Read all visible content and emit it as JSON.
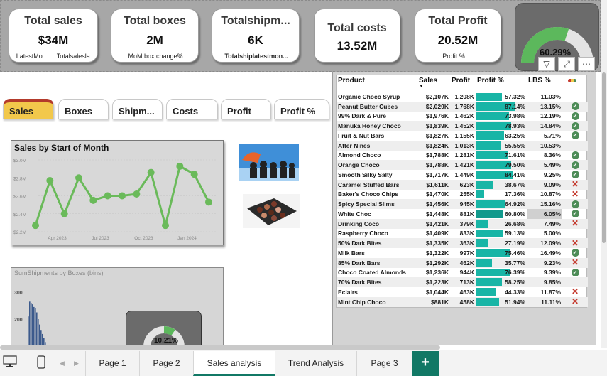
{
  "kpis": [
    {
      "title": "Total sales",
      "value": "$34M",
      "sub1": "LatestMo...",
      "sub2": "Totalsalesla..."
    },
    {
      "title": "Total boxes",
      "value": "2M",
      "sub1": "MoM box change%"
    },
    {
      "title": "Totalshipm...",
      "value": "6K",
      "sub1": "Totalshiplatestmon..."
    },
    {
      "title": "Total costs",
      "value": "13.52M"
    },
    {
      "title": "Total Profit",
      "value": "20.52M",
      "sub1": "Profit %"
    }
  ],
  "gauge": {
    "value": "60.29%",
    "fraction": 0.6029,
    "fill_color": "#5cb85c",
    "track_color": "#e4e4e4"
  },
  "visual_icons": [
    "filter-icon",
    "focus-mode-icon",
    "more-options-icon"
  ],
  "tabs": [
    "Sales",
    "Boxes",
    "Shipm...",
    "Costs",
    "Profit",
    "Profit %"
  ],
  "line_chart": {
    "chart_data": {
      "type": "line",
      "title": "Sales by Start of Month",
      "y_tick_labels": [
        "$3.0M",
        "$2.8M",
        "$2.6M",
        "$2.4M",
        "$2.2M"
      ],
      "y_ticks": [
        3.0,
        2.8,
        2.6,
        2.4,
        2.2
      ],
      "x_tick_labels": [
        "Apr 2023",
        "Jul 2023",
        "Oct 2023",
        "Jan 2024"
      ],
      "ylim": [
        2.2,
        3.0
      ],
      "values": [
        2.27,
        2.77,
        2.4,
        2.8,
        2.55,
        2.6,
        2.6,
        2.62,
        2.86,
        2.27,
        2.93,
        2.84,
        2.53
      ],
      "line_color": "#6aba5a"
    }
  },
  "bar_chart": {
    "chart_data": {
      "type": "bar",
      "title": "SumShipments by Boxes (bins)",
      "y_tick_labels": [
        "300",
        "200"
      ],
      "values": [
        210,
        265,
        260,
        255,
        245,
        240,
        225,
        200,
        180,
        160,
        145,
        130,
        115,
        100,
        90,
        80,
        70,
        60,
        52,
        45,
        40,
        35,
        30,
        26,
        22,
        18,
        15,
        12,
        10,
        8,
        6,
        5,
        4,
        3
      ]
    },
    "donut_value": "10.21%"
  },
  "table": {
    "headers": {
      "product": "Product",
      "sales": "Sales",
      "profit": "Profit",
      "profit_pct": "Profit %",
      "lbs_pct": "LBS %"
    },
    "rows": [
      {
        "product": "Organic Choco Syrup",
        "sales": "$2,107K",
        "profit": "1,208K",
        "pct": "57.32%",
        "pct_val": 0.5732,
        "lbs": "11.03%",
        "status": "none"
      },
      {
        "product": "Peanut Butter Cubes",
        "sales": "$2,029K",
        "profit": "1,768K",
        "pct": "87.14%",
        "pct_val": 0.8714,
        "lbs": "13.15%",
        "status": "ok"
      },
      {
        "product": "99% Dark & Pure",
        "sales": "$1,976K",
        "profit": "1,462K",
        "pct": "73.98%",
        "pct_val": 0.7398,
        "lbs": "12.19%",
        "status": "ok"
      },
      {
        "product": "Manuka Honey Choco",
        "sales": "$1,839K",
        "profit": "1,452K",
        "pct": "78.93%",
        "pct_val": 0.7893,
        "lbs": "14.84%",
        "status": "ok"
      },
      {
        "product": "Fruit & Nut Bars",
        "sales": "$1,827K",
        "profit": "1,155K",
        "pct": "63.25%",
        "pct_val": 0.6325,
        "lbs": "5.71%",
        "status": "ok"
      },
      {
        "product": "After Nines",
        "sales": "$1,824K",
        "profit": "1,013K",
        "pct": "55.55%",
        "pct_val": 0.5555,
        "lbs": "10.53%",
        "status": "none"
      },
      {
        "product": "Almond Choco",
        "sales": "$1,788K",
        "profit": "1,281K",
        "pct": "71.61%",
        "pct_val": 0.7161,
        "lbs": "8.36%",
        "status": "ok"
      },
      {
        "product": "Orange Choco",
        "sales": "$1,788K",
        "profit": "1,421K",
        "pct": "79.50%",
        "pct_val": 0.795,
        "lbs": "5.49%",
        "status": "ok"
      },
      {
        "product": "Smooth Silky Salty",
        "sales": "$1,717K",
        "profit": "1,449K",
        "pct": "84.41%",
        "pct_val": 0.8441,
        "lbs": "9.25%",
        "status": "ok"
      },
      {
        "product": "Caramel Stuffed Bars",
        "sales": "$1,611K",
        "profit": "623K",
        "pct": "38.67%",
        "pct_val": 0.3867,
        "lbs": "9.09%",
        "status": "bad"
      },
      {
        "product": "Baker's Choco Chips",
        "sales": "$1,470K",
        "profit": "255K",
        "pct": "17.36%",
        "pct_val": 0.1736,
        "lbs": "10.87%",
        "status": "bad"
      },
      {
        "product": "Spicy Special Slims",
        "sales": "$1,456K",
        "profit": "945K",
        "pct": "64.92%",
        "pct_val": 0.6492,
        "lbs": "15.16%",
        "status": "ok"
      },
      {
        "product": "White Choc",
        "sales": "$1,448K",
        "profit": "881K",
        "pct": "60.80%",
        "pct_val": 0.608,
        "lbs": "6.05%",
        "status": "ok",
        "highlight": true
      },
      {
        "product": "Drinking Coco",
        "sales": "$1,421K",
        "profit": "379K",
        "pct": "26.68%",
        "pct_val": 0.2668,
        "lbs": "7.49%",
        "status": "bad"
      },
      {
        "product": "Raspberry Choco",
        "sales": "$1,409K",
        "profit": "833K",
        "pct": "59.13%",
        "pct_val": 0.5913,
        "lbs": "5.00%",
        "status": "none"
      },
      {
        "product": "50% Dark Bites",
        "sales": "$1,335K",
        "profit": "363K",
        "pct": "27.19%",
        "pct_val": 0.2719,
        "lbs": "12.09%",
        "status": "bad"
      },
      {
        "product": "Milk Bars",
        "sales": "$1,322K",
        "profit": "997K",
        "pct": "75.46%",
        "pct_val": 0.7546,
        "lbs": "16.49%",
        "status": "ok"
      },
      {
        "product": "85% Dark Bars",
        "sales": "$1,292K",
        "profit": "462K",
        "pct": "35.77%",
        "pct_val": 0.3577,
        "lbs": "9.23%",
        "status": "bad"
      },
      {
        "product": "Choco Coated Almonds",
        "sales": "$1,236K",
        "profit": "944K",
        "pct": "76.39%",
        "pct_val": 0.7639,
        "lbs": "9.39%",
        "status": "ok"
      },
      {
        "product": "70% Dark Bites",
        "sales": "$1,223K",
        "profit": "713K",
        "pct": "58.25%",
        "pct_val": 0.5825,
        "lbs": "9.85%",
        "status": "none"
      },
      {
        "product": "Eclairs",
        "sales": "$1,044K",
        "profit": "463K",
        "pct": "44.33%",
        "pct_val": 0.4433,
        "lbs": "11.87%",
        "status": "bad"
      },
      {
        "product": "Mint Chip Choco",
        "sales": "$881K",
        "profit": "458K",
        "pct": "51.94%",
        "pct_val": 0.5194,
        "lbs": "11.11%",
        "status": "bad"
      }
    ]
  },
  "pages": [
    "Page 1",
    "Page 2",
    "Sales analysis",
    "Trend Analysis",
    "Page 3"
  ],
  "active_page": "Sales analysis",
  "add_page_label": "+",
  "colors": {
    "accent": "#117865",
    "bar_fill": "#18b5a6",
    "ok": "#4d8c57",
    "bad": "#c43a2e",
    "tab_active": "#f2c84b"
  }
}
